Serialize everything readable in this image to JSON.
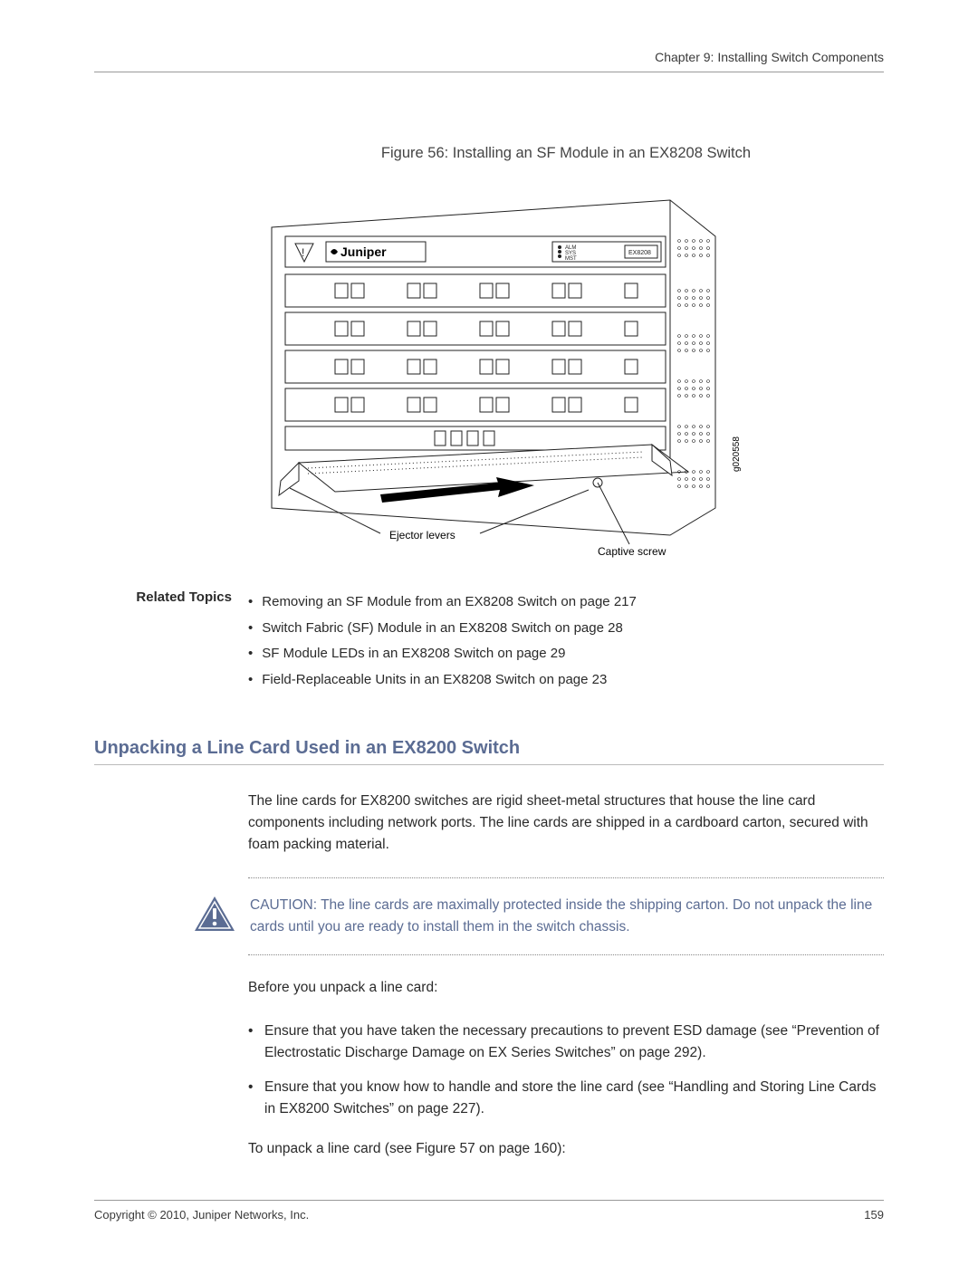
{
  "header": {
    "chapter": "Chapter 9: Installing Switch Components"
  },
  "figure": {
    "caption": "Figure 56: Installing an SF Module in an EX8208 Switch",
    "brand": "Juniper",
    "labels": {
      "ejector": "Ejector levers",
      "captive": "Captive screw",
      "code": "g020558",
      "model": "EX8208",
      "led1": "ALM",
      "led2": "SYS",
      "led3": "MST"
    }
  },
  "related": {
    "label": "Related Topics",
    "items": [
      "Removing an SF Module from an EX8208 Switch on page 217",
      "Switch Fabric (SF) Module in an EX8208 Switch on page 28",
      "SF Module LEDs in an EX8208 Switch on page 29",
      "Field-Replaceable Units in an EX8208 Switch on page 23"
    ]
  },
  "section": {
    "heading": "Unpacking a Line Card Used in an EX8200 Switch",
    "intro": "The line cards for EX8200 switches are rigid sheet-metal structures that house the line card components including network ports. The line cards are shipped in a cardboard carton, secured with foam packing material.",
    "caution_label": "CAUTION:",
    "caution_text": "The line cards are maximally protected inside the shipping carton. Do not unpack the line cards until you are ready to install them in the switch chassis.",
    "before": "Before you unpack a line card:",
    "steps": [
      "Ensure that you have taken the necessary precautions to prevent ESD damage (see “Prevention of Electrostatic Discharge Damage on EX Series Switches” on page 292).",
      "Ensure that you know how to handle and store the line card (see “Handling and Storing Line Cards in EX8200 Switches” on page 227)."
    ],
    "unpack": "To unpack a line card (see Figure 57 on page 160):"
  },
  "footer": {
    "copyright": "Copyright © 2010, Juniper Networks, Inc.",
    "page": "159"
  }
}
